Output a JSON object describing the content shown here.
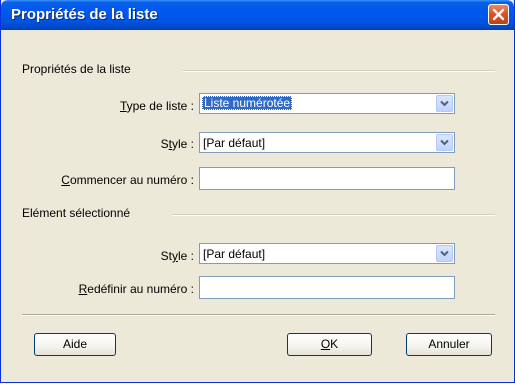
{
  "window": {
    "title": "Propriétés de la liste"
  },
  "list_properties": {
    "group_title": "Propriétés de la liste",
    "type": {
      "label_underlined": "T",
      "label_rest": "ype de liste :",
      "value": "Liste numérotée"
    },
    "style": {
      "label_before": "S",
      "label_underlined": "t",
      "label_after": "yle :",
      "value": "[Par défaut]"
    },
    "start": {
      "label_underlined": "C",
      "label_rest": "ommencer au numéro :",
      "value": ""
    }
  },
  "selected_item": {
    "group_title": "Elément sélectionné",
    "style": {
      "label_before": "St",
      "label_underlined": "y",
      "label_after": "le :",
      "value": "[Par défaut]"
    },
    "reset": {
      "label_underlined": "R",
      "label_rest": "edéfinir au numéro :",
      "value": ""
    }
  },
  "buttons": {
    "help": "Aide",
    "ok": "OK",
    "ok_underlined": "O",
    "ok_rest": "K",
    "cancel": "Annuler"
  }
}
